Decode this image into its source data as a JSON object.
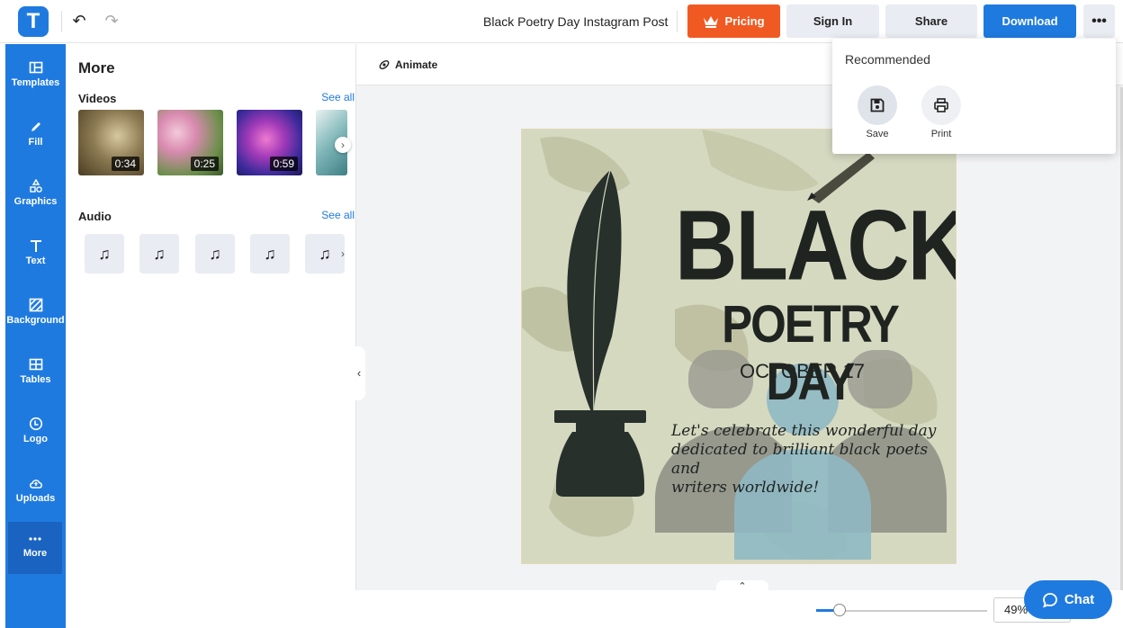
{
  "header": {
    "logo_letter": "T",
    "doc_title": "Black Poetry Day Instagram Post",
    "pricing_label": "Pricing",
    "signin_label": "Sign In",
    "share_label": "Share",
    "download_label": "Download",
    "more_label": "•••",
    "accent_color": "#1f7ae0",
    "pricing_color": "#f05a22"
  },
  "sidebar": {
    "items": [
      {
        "label": "Templates",
        "icon": "templates-icon"
      },
      {
        "label": "Fill",
        "icon": "pencil-icon"
      },
      {
        "label": "Graphics",
        "icon": "shapes-icon"
      },
      {
        "label": "Text",
        "icon": "text-icon"
      },
      {
        "label": "Background",
        "icon": "background-icon"
      },
      {
        "label": "Tables",
        "icon": "table-icon"
      },
      {
        "label": "Logo",
        "icon": "logo-icon"
      },
      {
        "label": "Uploads",
        "icon": "upload-cloud-icon"
      },
      {
        "label": "More",
        "icon": "more-dots-icon",
        "active": true
      }
    ]
  },
  "panel": {
    "title": "More",
    "videos_title": "Videos",
    "videos_see_all": "See all",
    "videos": [
      {
        "duration": "0:34"
      },
      {
        "duration": "0:25"
      },
      {
        "duration": "0:59"
      }
    ],
    "audio_title": "Audio",
    "audio_see_all": "See all",
    "audio_count_visible": 5
  },
  "canvas": {
    "animate_label": "Animate",
    "poster": {
      "headline": "BLACK",
      "subheadline": "POETRY DAY",
      "date": "OCTOBER 17",
      "tagline_1": "Let's celebrate this wonderful day",
      "tagline_2": "dedicated to brilliant black poets and",
      "tagline_3": "writers worldwide!"
    }
  },
  "dropdown": {
    "title": "Recommended",
    "items": [
      {
        "label": "Save",
        "icon": "save-icon"
      },
      {
        "label": "Print",
        "icon": "print-icon"
      }
    ]
  },
  "status": {
    "zoom": "49%",
    "chat_label": "Chat"
  }
}
